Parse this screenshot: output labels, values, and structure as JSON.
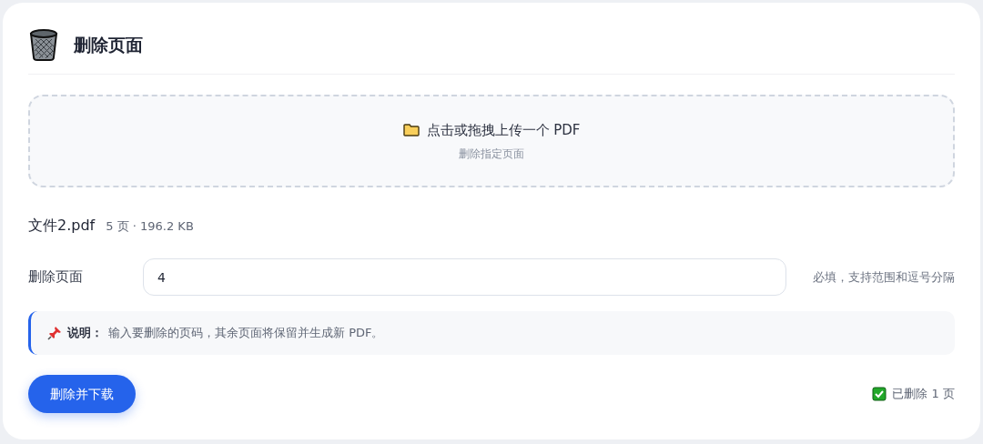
{
  "header": {
    "title": "删除页面"
  },
  "dropzone": {
    "label": "点击或拖拽上传一个 PDF",
    "hint": "删除指定页面"
  },
  "file": {
    "name": "文件2.pdf",
    "meta": "5 页 · 196.2 KB"
  },
  "field": {
    "label": "删除页面",
    "value": "4",
    "help": "必填，支持范围和逗号分隔"
  },
  "note": {
    "label": "说明：",
    "text": "输入要删除的页码，其余页面将保留并生成新 PDF。"
  },
  "action": {
    "label": "删除并下载"
  },
  "status": {
    "text": "已删除 1 页",
    "done": true
  }
}
